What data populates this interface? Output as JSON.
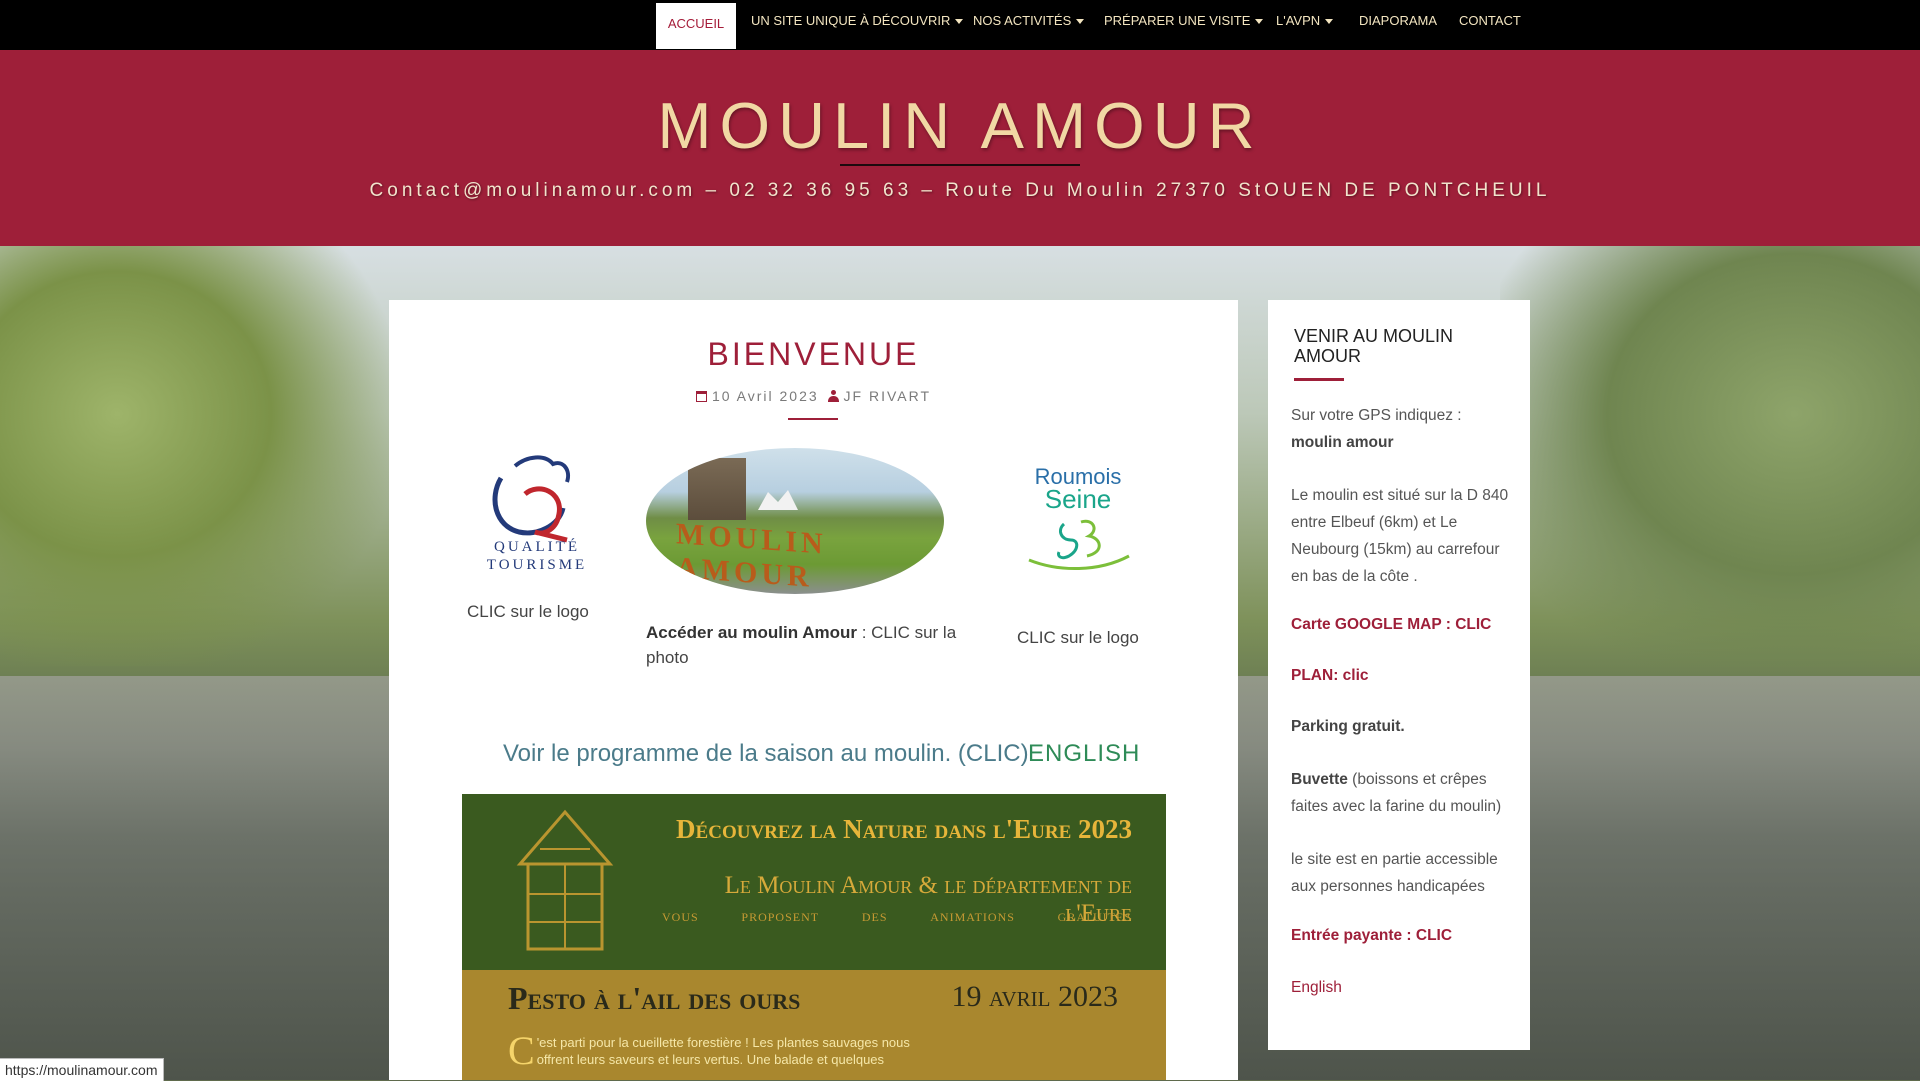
{
  "nav": {
    "items": [
      {
        "label": "ACCUEIL",
        "active": true,
        "dropdown": false
      },
      {
        "label": "UN SITE UNIQUE À DÉCOUVRIR",
        "active": false,
        "dropdown": true
      },
      {
        "label": "NOS ACTIVITÉS",
        "active": false,
        "dropdown": true
      },
      {
        "label": "PRÉPARER UNE VISITE",
        "active": false,
        "dropdown": true
      },
      {
        "label": "L'AVPN",
        "active": false,
        "dropdown": true
      },
      {
        "label": "DIAPORAMA",
        "active": false,
        "dropdown": false
      },
      {
        "label": "CONTACT",
        "active": false,
        "dropdown": false
      }
    ]
  },
  "header": {
    "title": "MOULIN AMOUR",
    "tagline": "Contact@moulinamour.com – 02 32 36 95 63 – Route Du Moulin 27370 StOUEN DE PONTCHEUIL"
  },
  "post": {
    "title": "BIENVENUE",
    "date": "10 Avril 2023",
    "author": "JF RIVART",
    "logo_qt_line1": "QUALITÉ",
    "logo_qt_line2": "TOURISME",
    "clic_logo_1": "CLIC sur le logo",
    "photo_sign": "MOULIN AMOUR",
    "acceder_bold": "Accéder au moulin Amour",
    "acceder_rest": " : CLIC sur la photo",
    "logo_rs_line1": "Roumois",
    "logo_rs_line2": "Seine",
    "clic_logo_2": "CLIC sur le logo",
    "programme_link": "Voir le programme de la saison au moulin. (CLIC)",
    "english_link": "ENGLISH"
  },
  "poster": {
    "title": "Découvrez la Nature dans l'Eure 2023",
    "subtitle": "Le Moulin Amour & le département de l'Eure",
    "subtitle2": "vous proposent des animations gratuites",
    "event_title": "Pesto à l'ail des ours",
    "event_date": "19 avril 2023",
    "text_drop": "C",
    "text": "'est parti pour la cueillette forestière ! Les plantes sauvages nous offrent leurs saveurs et leurs vertus. Une balade et quelques"
  },
  "sidebar": {
    "title": "VENIR AU MOULIN AMOUR",
    "gps_prefix": "Sur votre GPS indiquez : ",
    "gps_value": "moulin amour",
    "location": "Le moulin est situé sur la D 840 entre Elbeuf (6km) et Le Neubourg (15km) au carrefour en bas de la côte .",
    "map_link": "Carte GOOGLE MAP : CLIC",
    "plan_link": "PLAN: clic",
    "parking": "Parking gratuit.",
    "buvette_bold": "Buvette",
    "buvette_rest": " (boissons et crêpes faites avec la farine du moulin)",
    "access": "le site est en partie accessible aux personnes handicapées",
    "entree_link": "Entrée payante : CLIC",
    "english_link": "English"
  },
  "statusbar": {
    "url": "https://moulinamour.com"
  },
  "colors": {
    "brand": "#9e1f39",
    "title_gold": "#f1d8a4",
    "nav_bg": "#000000"
  }
}
